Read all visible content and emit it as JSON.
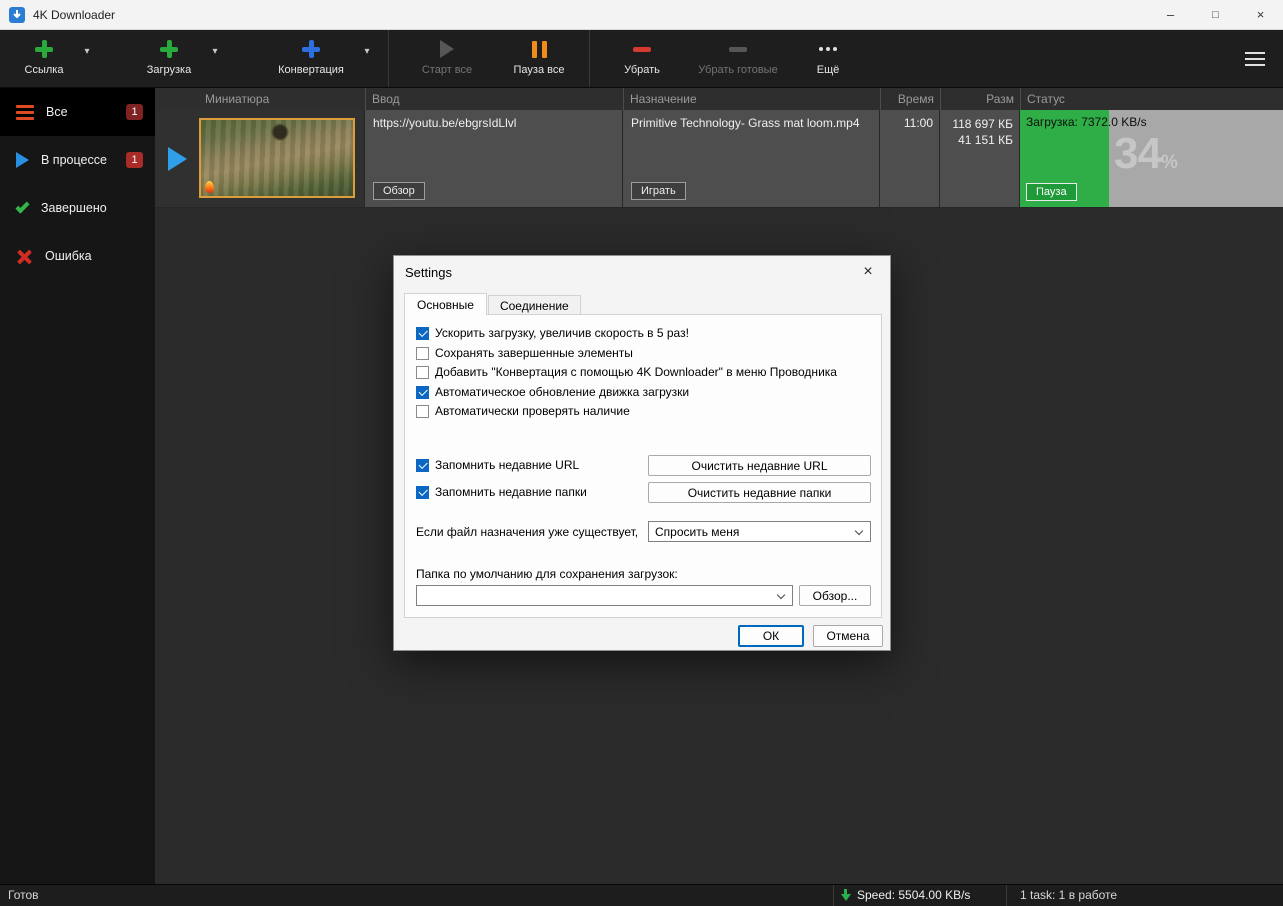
{
  "icons": {
    "caret": "▾",
    "minimize": "–",
    "maximize": "□",
    "close": "×"
  },
  "window": {
    "title": "4K Downloader"
  },
  "toolbar": {
    "items": [
      {
        "label": "Ссылка"
      },
      {
        "label": "Загрузка"
      },
      {
        "label": "Конвертация"
      },
      {
        "label": "Старт все",
        "disabled": true
      },
      {
        "label": "Пауза все"
      },
      {
        "label": "Убрать"
      },
      {
        "label": "Убрать готовые",
        "disabled": true
      },
      {
        "label": "Ещё"
      }
    ]
  },
  "sidebar": {
    "items": [
      {
        "label": "Все",
        "badge": "1",
        "selected": true
      },
      {
        "label": "В процессе",
        "badge": "1"
      },
      {
        "label": "Завершено"
      },
      {
        "label": "Ошибка"
      }
    ]
  },
  "table": {
    "columns": [
      "Миниатюра",
      "Ввод",
      "Назначение",
      "Время",
      "Разм",
      "Статус"
    ],
    "row": {
      "url": "https://youtu.be/ebgrsIdLlvl",
      "browse_label": "Обзор",
      "destination": "Primitive Technology- Grass mat loom.mp4",
      "play_label": "Играть",
      "time": "11:00",
      "size_total": "118 697 КБ",
      "size_done": "41 151 КБ",
      "status_text": "Загрузка: 7372.0 KB/s",
      "progress_value": "34",
      "progress_unit": "%",
      "progress_percent": 34,
      "pause_label": "Пауза"
    }
  },
  "dialog": {
    "title": "Settings",
    "tabs": [
      {
        "label": "Основные",
        "active": true
      },
      {
        "label": "Соединение",
        "active": false
      }
    ],
    "checkboxes": [
      {
        "label": "Ускорить загрузку, увеличив скорость в 5 раз!",
        "checked": true
      },
      {
        "label": "Сохранять завершенные элементы",
        "checked": false
      },
      {
        "label": "Добавить \"Конвертация с помощью 4K Downloader\" в меню Проводника",
        "checked": false
      },
      {
        "label": "Автоматическое обновление движка загрузки",
        "checked": true
      },
      {
        "label": "Автоматически проверять наличие",
        "checked": false
      }
    ],
    "remember_url": {
      "label": "Запомнить недавние URL",
      "checked": true,
      "button": "Очистить недавние URL"
    },
    "remember_folders": {
      "label": "Запомнить недавние папки",
      "checked": true,
      "button": "Очистить недавние папки"
    },
    "exists": {
      "label": "Если файл назначения уже существует,",
      "value": "Спросить меня"
    },
    "default_folder": {
      "label": "Папка по умолчанию для сохранения загрузок:",
      "value": "",
      "browse": "Обзор..."
    },
    "ok": "ОК",
    "cancel": "Отмена"
  },
  "statusbar": {
    "ready": "Готов",
    "speed": "Speed: 5504.00 KB/s",
    "tasks": "1 task: 1 в работе"
  }
}
